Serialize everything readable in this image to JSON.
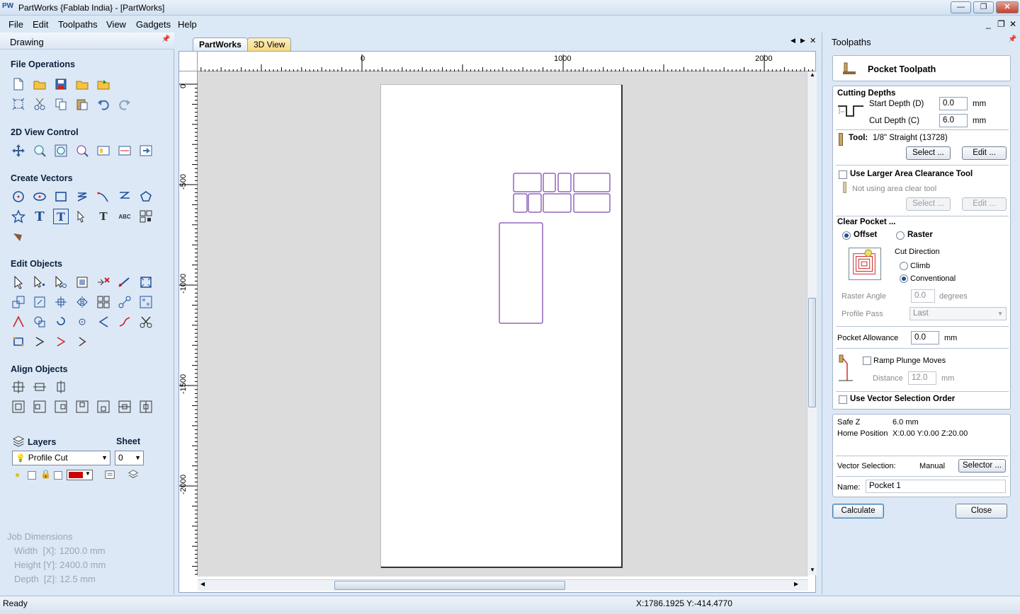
{
  "window": {
    "app_icon": "PW",
    "title": "PartWorks {Fablab India} - [PartWorks]",
    "min": "—",
    "max": "❐",
    "close": "✕"
  },
  "menu": {
    "items": [
      "File",
      "Edit",
      "Toolpaths",
      "View",
      "Gadgets",
      "Help"
    ],
    "mdi_min": "_",
    "mdi_restore": "❐",
    "mdi_close": "✕"
  },
  "left": {
    "title": "Drawing",
    "pin": "📌",
    "sections": {
      "file_ops": "File Operations",
      "view_control": "2D View Control",
      "create_vectors": "Create Vectors",
      "edit_objects": "Edit Objects",
      "align_objects": "Align Objects"
    },
    "layers": {
      "label": "Layers",
      "sheet_label": "Sheet",
      "layer_value": "Profile Cut",
      "sheet_value": "0"
    },
    "job": {
      "title": "Job Dimensions",
      "width": "Width  [X]: 1200.0 mm",
      "height": "Height [Y]: 2400.0 mm",
      "depth": "Depth  [Z]: 12.5 mm"
    }
  },
  "center": {
    "tabs": [
      "PartWorks",
      "3D View"
    ],
    "nav": [
      "◀",
      "▶",
      "✕"
    ],
    "hruler_labels": [
      "0",
      "1000",
      "2000"
    ],
    "vruler_labels": [
      "0",
      "-500",
      "-1000",
      "-1500",
      "-2000"
    ]
  },
  "right": {
    "title": "Toolpaths",
    "pin": "📌",
    "header": "Pocket Toolpath",
    "cutting_depths": {
      "title": "Cutting Depths",
      "start_label": "Start Depth (D)",
      "start_value": "0.0",
      "cut_label": "Cut Depth (C)",
      "cut_value": "6.0",
      "unit": "mm"
    },
    "tool": {
      "label": "Tool:",
      "value": "1/8\" Straight (13728)",
      "select": "Select ...",
      "edit": "Edit ..."
    },
    "larger": {
      "label": "Use Larger Area Clearance Tool",
      "note": "Not using area clear tool",
      "select": "Select ...",
      "edit": "Edit ..."
    },
    "clear": {
      "title": "Clear Pocket ...",
      "offset": "Offset",
      "raster": "Raster",
      "cut_direction": "Cut Direction",
      "climb": "Climb",
      "conventional": "Conventional",
      "raster_angle": "Raster Angle",
      "raster_value": "0.0",
      "degrees": "degrees",
      "profile_pass": "Profile Pass",
      "profile_value": "Last"
    },
    "allowance": {
      "label": "Pocket Allowance",
      "value": "0.0",
      "unit": "mm"
    },
    "ramp": {
      "label": "Ramp Plunge Moves",
      "distance": "Distance",
      "value": "12.0",
      "unit": "mm"
    },
    "vector_order": "Use Vector Selection Order",
    "info": {
      "safe_z_label": "Safe Z",
      "safe_z": "6.0 mm",
      "home_label": "Home Position",
      "home": "X:0.00 Y:0.00 Z:20.00",
      "vs_label": "Vector Selection:",
      "vs_value": "Manual",
      "selector": "Selector ..."
    },
    "name_label": "Name:",
    "name_value": "Pocket 1",
    "calculate": "Calculate",
    "close": "Close"
  },
  "status": {
    "ready": "Ready",
    "coords": "X:1786.1925 Y:-414.4770"
  },
  "colors": {
    "vector": "#5b1a9c",
    "accent": "#1e4f9a",
    "layer_color": "#cc0000"
  }
}
